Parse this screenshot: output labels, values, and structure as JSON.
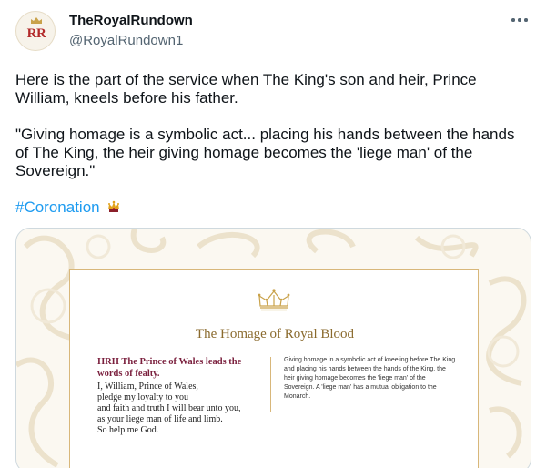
{
  "tweet": {
    "author": {
      "avatar_text": "RR",
      "display_name": "TheRoyalRundown",
      "handle": "@RoyalRundown1"
    },
    "menu_icon": "more-dots-icon",
    "text_paragraph_1": "Here is the part of the service when The King's son and heir, Prince William, kneels before his father.",
    "text_paragraph_2": "\"Giving homage is a symbolic act... placing his hands between the hands of The King, the heir giving homage becomes the 'liege man' of the Sovereign.\"",
    "hashtag": "#Coronation",
    "hashtag_emoji": "crown-emoji-icon",
    "colors": {
      "link": "#1d9bf0",
      "text": "#0f1419",
      "secondary": "#536471",
      "gold": "#8a6a2d",
      "burgundy": "#7a1f3d"
    }
  },
  "media": {
    "title": "The Homage of Royal Blood",
    "left_heading": "HRH The Prince of Wales leads the words of fealty.",
    "oath_lines": [
      "I, William, Prince of Wales,",
      "pledge my loyalty to you",
      "and faith and truth I will bear unto you,",
      "as your liege man of life and limb.",
      "So help me God."
    ],
    "right_text": "Giving homage in a symbolic act of kneeling before The King and placing his hands between the hands of the King, the heir giving homage becomes the 'liege man' of the Sovereign. A 'liege man' has a mutual obligation to the Monarch."
  }
}
